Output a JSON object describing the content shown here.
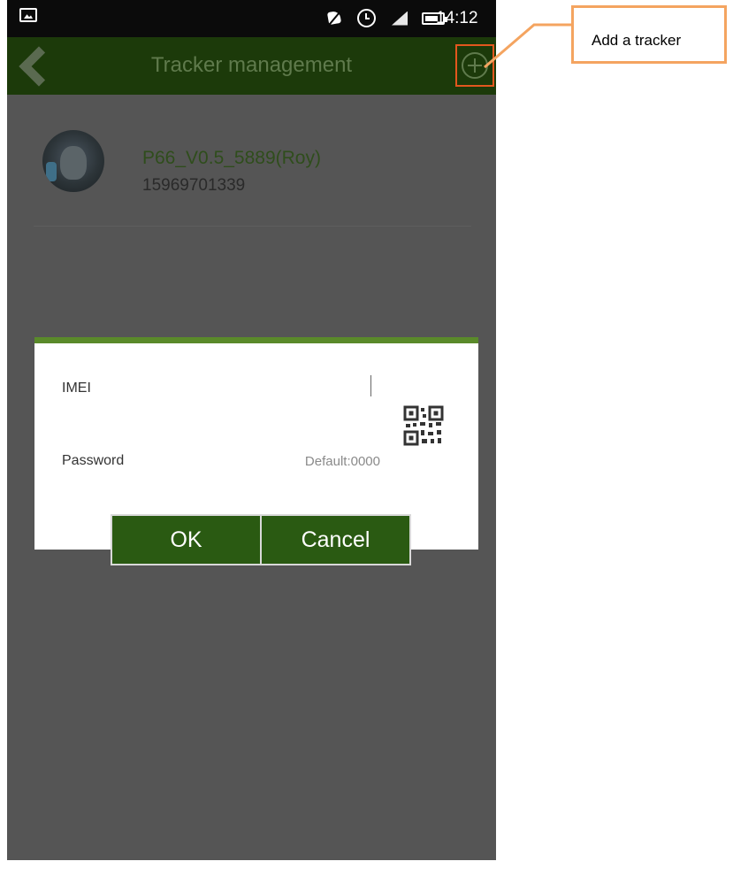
{
  "status_bar": {
    "time": "14:12"
  },
  "header": {
    "title": "Tracker management"
  },
  "trackers": [
    {
      "name": "P66_V0.5_5889(Roy)",
      "phone": "15969701339"
    }
  ],
  "dialog": {
    "imei_label": "IMEI",
    "imei_value": "",
    "password_label": "Password",
    "password_placeholder": "Default:0000",
    "ok_label": "OK",
    "cancel_label": "Cancel"
  },
  "callout": {
    "text": "Add a tracker"
  },
  "colors": {
    "header_bg": "#1c3a0a",
    "button_bg": "#2a5a12",
    "accent_green": "#5a8a2a",
    "highlight_orange": "#f4a460"
  },
  "icons": [
    "gallery-icon",
    "mute-icon",
    "alarm-icon",
    "signal-icon",
    "battery-icon",
    "back-icon",
    "add-icon",
    "qr-code-icon"
  ]
}
